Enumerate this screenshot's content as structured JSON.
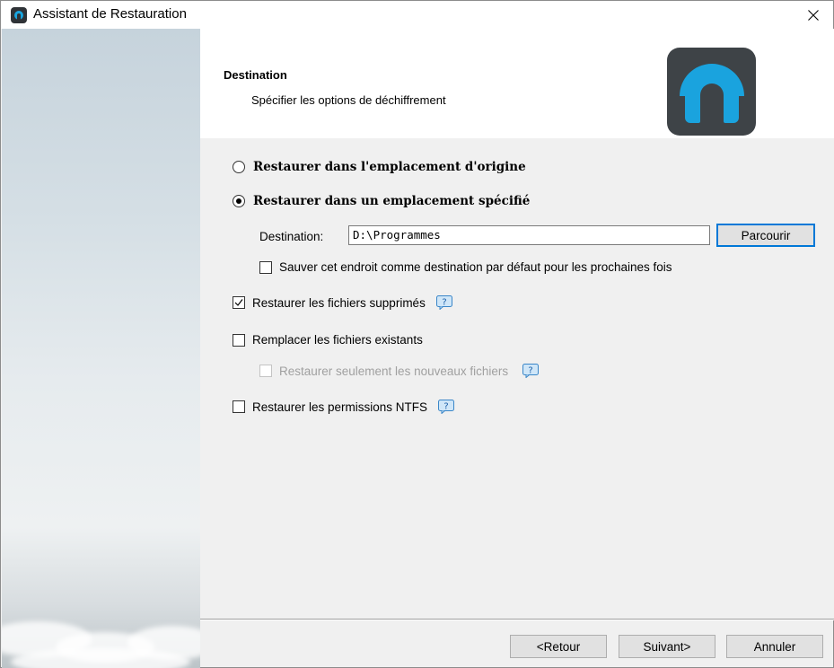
{
  "window": {
    "title": "Assistant de Restauration"
  },
  "header": {
    "title": "Destination",
    "subtitle": "Spécifier les options de déchiffrement"
  },
  "options": {
    "radio_original": {
      "label": "Restaurer dans l'emplacement d'origine",
      "checked": false
    },
    "radio_specified": {
      "label": "Restaurer dans un emplacement spécifié",
      "checked": true
    },
    "destination": {
      "label": "Destination:",
      "value": "D:\\Programmes"
    },
    "browse_label": "Parcourir",
    "save_default": {
      "label": "Sauver cet endroit comme destination par défaut pour les prochaines fois",
      "checked": false
    },
    "restore_deleted": {
      "label": "Restaurer les fichiers supprimés",
      "checked": true
    },
    "replace_existing": {
      "label": "Remplacer les fichiers existants",
      "checked": false
    },
    "only_new": {
      "label": "Restaurer seulement les nouveaux fichiers",
      "checked": false,
      "disabled": true
    },
    "ntfs_permissions": {
      "label": "Restaurer les permissions NTFS",
      "checked": false
    }
  },
  "footer": {
    "back_label": "<Retour",
    "next_label": "Suivant>",
    "cancel_label": "Annuler"
  },
  "colors": {
    "accent": "#0078d7",
    "logo_blue": "#1aa3de",
    "logo_dark": "#3e4347"
  }
}
